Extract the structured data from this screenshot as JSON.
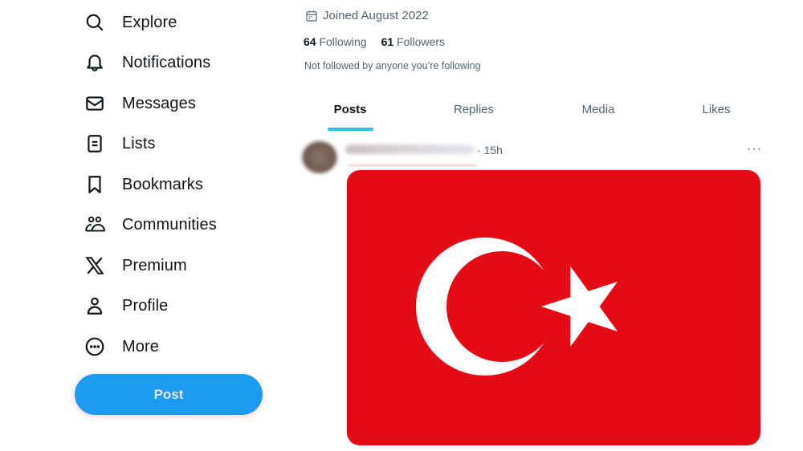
{
  "sidebar": {
    "items": [
      {
        "label": "Explore",
        "icon": "search-icon"
      },
      {
        "label": "Notifications",
        "icon": "bell-icon"
      },
      {
        "label": "Messages",
        "icon": "envelope-icon"
      },
      {
        "label": "Lists",
        "icon": "list-icon"
      },
      {
        "label": "Bookmarks",
        "icon": "bookmark-icon"
      },
      {
        "label": "Communities",
        "icon": "communities-icon"
      },
      {
        "label": "Premium",
        "icon": "x-logo-icon"
      },
      {
        "label": "Profile",
        "icon": "person-icon"
      },
      {
        "label": "More",
        "icon": "more-circle-icon"
      }
    ],
    "post_button": "Post"
  },
  "profile": {
    "joined": "Joined August 2022",
    "following_count": "64",
    "following_label": "Following",
    "followers_count": "61",
    "followers_label": "Followers",
    "not_followed": "Not followed by anyone you’re following"
  },
  "tabs": [
    {
      "label": "Posts",
      "active": true
    },
    {
      "label": "Replies",
      "active": false
    },
    {
      "label": "Media",
      "active": false
    },
    {
      "label": "Likes",
      "active": false
    }
  ],
  "post": {
    "timestamp": "· 15h",
    "more": "···",
    "media": "Turkish flag image (white crescent and star on red)",
    "colors": {
      "flag_red": "#e30a17",
      "flag_white": "#ffffff"
    }
  },
  "colors": {
    "accent": "#1d9bf0",
    "tab_indicator": "#1dc8e4",
    "text_primary": "#0f1419",
    "text_secondary": "#536471"
  }
}
